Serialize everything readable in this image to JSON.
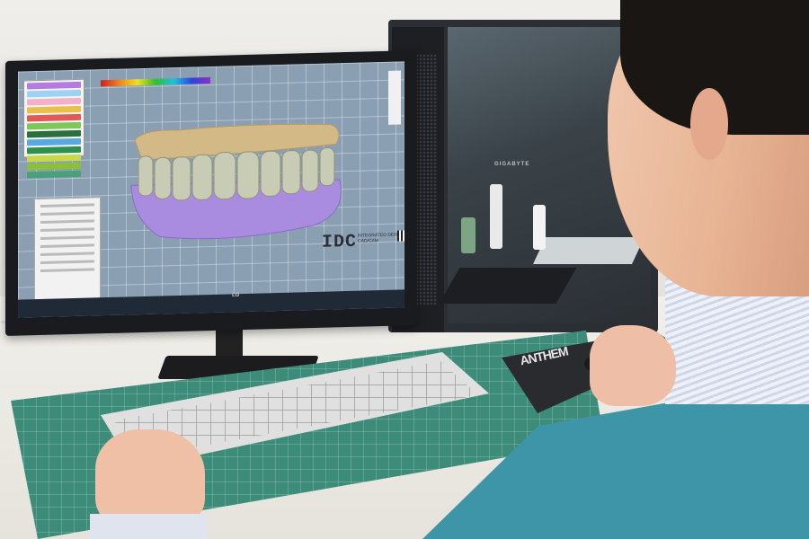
{
  "scene": {
    "monitor_brand": "LG",
    "case_brand": "GIGABYTE",
    "screen_logo": "IDC",
    "screen_logo_sub": "INTEGRATED DENTAL CAD/CAM",
    "mousepad_text": "ANTHEM"
  },
  "colors": {
    "mat": "#3c8c79",
    "sweater": "#3f95a8",
    "gum_model": "#a98be0",
    "teeth": "#c9ccb4",
    "upper_model": "#d2b985"
  },
  "layer_colors": [
    "#b57be0",
    "#9bd3f0",
    "#f3b0c8",
    "#e8c04a",
    "#e05a5a",
    "#7ec85b",
    "#2d6e3e",
    "#5aa8e0",
    "#2f8f4f",
    "#c9d84a",
    "#8cbf3a",
    "#4aa07a"
  ]
}
